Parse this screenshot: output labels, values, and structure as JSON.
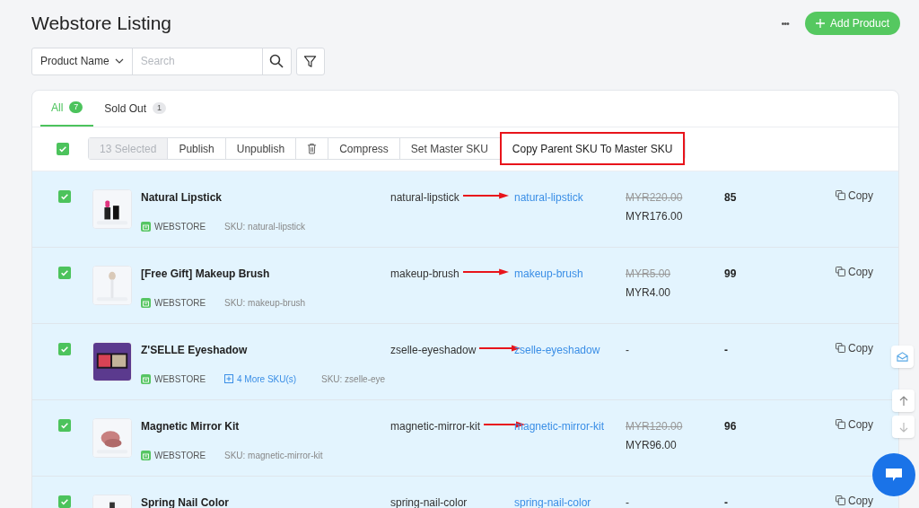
{
  "title": "Webstore Listing",
  "header_actions": {
    "more": "•••",
    "add_button": "Add Product"
  },
  "filter": {
    "field": "Product Name",
    "placeholder": "Search"
  },
  "tabs": [
    {
      "label": "All",
      "count": "7",
      "selected": true
    },
    {
      "label": "Sold Out",
      "count": "1",
      "selected": false
    }
  ],
  "toolbar": {
    "select_all_checked": true,
    "selected_count": "13 Selected",
    "actions": [
      {
        "kind": "text",
        "label": "Publish",
        "highlighted": false
      },
      {
        "kind": "text",
        "label": "Unpublish",
        "highlighted": false
      },
      {
        "kind": "delete",
        "highlighted": false
      },
      {
        "kind": "text",
        "label": "Compress",
        "highlighted": false
      },
      {
        "kind": "text",
        "label": "Set Master SKU",
        "highlighted": false
      },
      {
        "kind": "text",
        "label": "Copy Parent SKU To Master SKU",
        "highlighted": true
      }
    ]
  },
  "rows": [
    {
      "checked": true,
      "name": "Natural Lipstick",
      "channel": "WEBSTORE",
      "more_skus": null,
      "sku": "SKU: natural-lipstick",
      "parent_sku": "natural-lipstick",
      "arrow": true,
      "master_sku": "natural-lipstick",
      "old_price": "MYR220.00",
      "price": "MYR176.00",
      "stock": "85",
      "action": "Copy"
    },
    {
      "checked": true,
      "name": "[Free Gift] Makeup Brush",
      "channel": "WEBSTORE",
      "more_skus": null,
      "sku": "SKU: makeup-brush",
      "parent_sku": "makeup-brush",
      "arrow": true,
      "master_sku": "makeup-brush",
      "old_price": "MYR5.00",
      "price": "MYR4.00",
      "stock": "99",
      "action": "Copy"
    },
    {
      "checked": true,
      "name": "Z'SELLE Eyeshadow",
      "channel": "WEBSTORE",
      "more_skus": "4 More SKU(s)",
      "sku": "SKU: zselle-eye",
      "parent_sku": "zselle-eyeshadow",
      "arrow": true,
      "master_sku": "zselle-eyeshadow",
      "old_price": null,
      "price": "-",
      "stock": "-",
      "action": "Copy"
    },
    {
      "checked": true,
      "name": "Magnetic Mirror Kit",
      "channel": "WEBSTORE",
      "more_skus": null,
      "sku": "SKU: magnetic-mirror-kit",
      "parent_sku": "magnetic-mirror-kit",
      "arrow": true,
      "master_sku": "magnetic-mirror-kit",
      "old_price": "MYR120.00",
      "price": "MYR96.00",
      "stock": "96",
      "action": "Copy"
    },
    {
      "checked": true,
      "name": "Spring Nail Color",
      "channel": null,
      "more_skus": null,
      "sku": null,
      "parent_sku": "spring-nail-color",
      "arrow": false,
      "master_sku": "spring-nail-color",
      "old_price": null,
      "price": "-",
      "stock": "-",
      "action": "Copy"
    }
  ]
}
